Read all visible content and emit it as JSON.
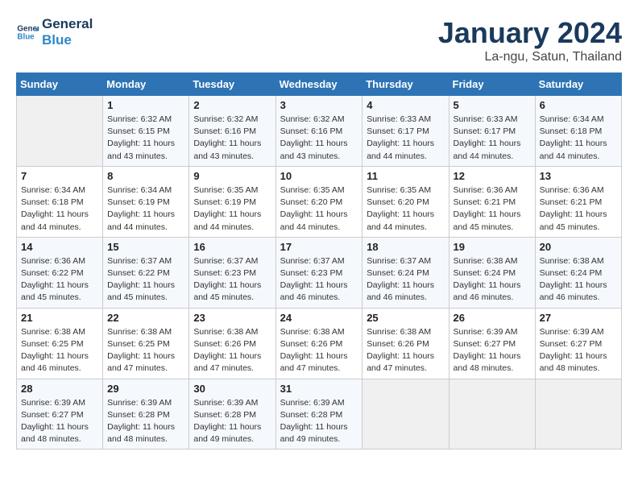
{
  "logo": {
    "line1": "General",
    "line2": "Blue"
  },
  "title": "January 2024",
  "location": "La-ngu, Satun, Thailand",
  "days_of_week": [
    "Sunday",
    "Monday",
    "Tuesday",
    "Wednesday",
    "Thursday",
    "Friday",
    "Saturday"
  ],
  "weeks": [
    [
      {
        "day": "",
        "info": ""
      },
      {
        "day": "1",
        "info": "Sunrise: 6:32 AM\nSunset: 6:15 PM\nDaylight: 11 hours and 43 minutes."
      },
      {
        "day": "2",
        "info": "Sunrise: 6:32 AM\nSunset: 6:16 PM\nDaylight: 11 hours and 43 minutes."
      },
      {
        "day": "3",
        "info": "Sunrise: 6:32 AM\nSunset: 6:16 PM\nDaylight: 11 hours and 43 minutes."
      },
      {
        "day": "4",
        "info": "Sunrise: 6:33 AM\nSunset: 6:17 PM\nDaylight: 11 hours and 44 minutes."
      },
      {
        "day": "5",
        "info": "Sunrise: 6:33 AM\nSunset: 6:17 PM\nDaylight: 11 hours and 44 minutes."
      },
      {
        "day": "6",
        "info": "Sunrise: 6:34 AM\nSunset: 6:18 PM\nDaylight: 11 hours and 44 minutes."
      }
    ],
    [
      {
        "day": "7",
        "info": "Sunrise: 6:34 AM\nSunset: 6:18 PM\nDaylight: 11 hours and 44 minutes."
      },
      {
        "day": "8",
        "info": "Sunrise: 6:34 AM\nSunset: 6:19 PM\nDaylight: 11 hours and 44 minutes."
      },
      {
        "day": "9",
        "info": "Sunrise: 6:35 AM\nSunset: 6:19 PM\nDaylight: 11 hours and 44 minutes."
      },
      {
        "day": "10",
        "info": "Sunrise: 6:35 AM\nSunset: 6:20 PM\nDaylight: 11 hours and 44 minutes."
      },
      {
        "day": "11",
        "info": "Sunrise: 6:35 AM\nSunset: 6:20 PM\nDaylight: 11 hours and 44 minutes."
      },
      {
        "day": "12",
        "info": "Sunrise: 6:36 AM\nSunset: 6:21 PM\nDaylight: 11 hours and 45 minutes."
      },
      {
        "day": "13",
        "info": "Sunrise: 6:36 AM\nSunset: 6:21 PM\nDaylight: 11 hours and 45 minutes."
      }
    ],
    [
      {
        "day": "14",
        "info": "Sunrise: 6:36 AM\nSunset: 6:22 PM\nDaylight: 11 hours and 45 minutes."
      },
      {
        "day": "15",
        "info": "Sunrise: 6:37 AM\nSunset: 6:22 PM\nDaylight: 11 hours and 45 minutes."
      },
      {
        "day": "16",
        "info": "Sunrise: 6:37 AM\nSunset: 6:23 PM\nDaylight: 11 hours and 45 minutes."
      },
      {
        "day": "17",
        "info": "Sunrise: 6:37 AM\nSunset: 6:23 PM\nDaylight: 11 hours and 46 minutes."
      },
      {
        "day": "18",
        "info": "Sunrise: 6:37 AM\nSunset: 6:24 PM\nDaylight: 11 hours and 46 minutes."
      },
      {
        "day": "19",
        "info": "Sunrise: 6:38 AM\nSunset: 6:24 PM\nDaylight: 11 hours and 46 minutes."
      },
      {
        "day": "20",
        "info": "Sunrise: 6:38 AM\nSunset: 6:24 PM\nDaylight: 11 hours and 46 minutes."
      }
    ],
    [
      {
        "day": "21",
        "info": "Sunrise: 6:38 AM\nSunset: 6:25 PM\nDaylight: 11 hours and 46 minutes."
      },
      {
        "day": "22",
        "info": "Sunrise: 6:38 AM\nSunset: 6:25 PM\nDaylight: 11 hours and 47 minutes."
      },
      {
        "day": "23",
        "info": "Sunrise: 6:38 AM\nSunset: 6:26 PM\nDaylight: 11 hours and 47 minutes."
      },
      {
        "day": "24",
        "info": "Sunrise: 6:38 AM\nSunset: 6:26 PM\nDaylight: 11 hours and 47 minutes."
      },
      {
        "day": "25",
        "info": "Sunrise: 6:38 AM\nSunset: 6:26 PM\nDaylight: 11 hours and 47 minutes."
      },
      {
        "day": "26",
        "info": "Sunrise: 6:39 AM\nSunset: 6:27 PM\nDaylight: 11 hours and 48 minutes."
      },
      {
        "day": "27",
        "info": "Sunrise: 6:39 AM\nSunset: 6:27 PM\nDaylight: 11 hours and 48 minutes."
      }
    ],
    [
      {
        "day": "28",
        "info": "Sunrise: 6:39 AM\nSunset: 6:27 PM\nDaylight: 11 hours and 48 minutes."
      },
      {
        "day": "29",
        "info": "Sunrise: 6:39 AM\nSunset: 6:28 PM\nDaylight: 11 hours and 48 minutes."
      },
      {
        "day": "30",
        "info": "Sunrise: 6:39 AM\nSunset: 6:28 PM\nDaylight: 11 hours and 49 minutes."
      },
      {
        "day": "31",
        "info": "Sunrise: 6:39 AM\nSunset: 6:28 PM\nDaylight: 11 hours and 49 minutes."
      },
      {
        "day": "",
        "info": ""
      },
      {
        "day": "",
        "info": ""
      },
      {
        "day": "",
        "info": ""
      }
    ]
  ]
}
